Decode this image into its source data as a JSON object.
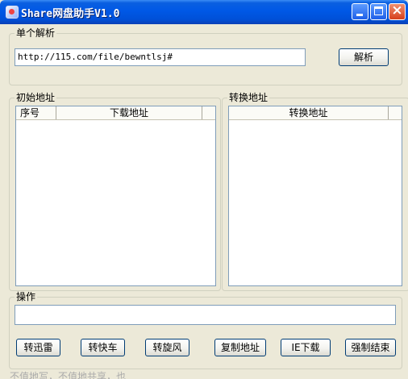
{
  "window": {
    "title": "Share网盘助手V1.0",
    "controls": [
      "minimize",
      "maximize",
      "close"
    ]
  },
  "single_parse": {
    "legend": "单个解析",
    "url_value": "http://115.com/file/bewntlsj#",
    "parse_button": "解析"
  },
  "original_urls": {
    "legend": "初始地址",
    "columns": [
      "序号",
      "下载地址"
    ],
    "rows": []
  },
  "converted_urls": {
    "legend": "转换地址",
    "columns": [
      "转换地址"
    ],
    "rows": []
  },
  "operations": {
    "legend": "操作",
    "log_value": "",
    "buttons": {
      "xunlei": "转迅雷",
      "kuaiche": "转快车",
      "xuanfeng": "转旋风",
      "copy": "复制地址",
      "ie_download": "IE下载",
      "force_end": "强制结束"
    }
  },
  "status": {
    "text": "不值地写，不值地共享，也"
  }
}
